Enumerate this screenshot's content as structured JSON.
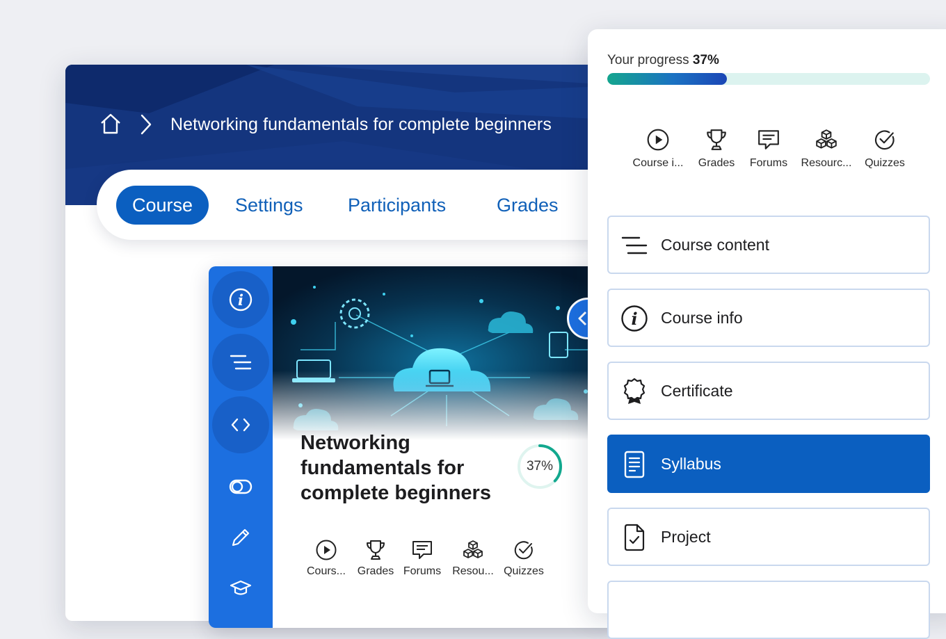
{
  "header": {
    "home_icon": "home-icon",
    "breadcrumb_title": "Networking fundamentals for complete beginners"
  },
  "tabs": [
    {
      "label": "Course",
      "active": true
    },
    {
      "label": "Settings",
      "active": false
    },
    {
      "label": "Participants",
      "active": false
    },
    {
      "label": "Grades",
      "active": false
    }
  ],
  "course_card": {
    "title": "Networking fundamentals for complete beginners",
    "progress_text": "37%",
    "progress_value": 0.37,
    "rail_icons": [
      "info-icon",
      "course-index-icon",
      "code-icon",
      "toggle-icon",
      "pencil-icon",
      "graduation-cap-icon"
    ],
    "quick_access": [
      {
        "label": "Cours...",
        "icon": "play-icon"
      },
      {
        "label": "Grades",
        "icon": "trophy-icon"
      },
      {
        "label": "Forums",
        "icon": "forum-icon"
      },
      {
        "label": "Resou...",
        "icon": "cubes-icon"
      },
      {
        "label": "Quizzes",
        "icon": "check-circle-icon"
      }
    ]
  },
  "panel": {
    "progress_label": "Your progress",
    "progress_value_text": "37%",
    "progress_value": 0.37,
    "quick_access": [
      {
        "label": "Course i...",
        "icon": "play-icon"
      },
      {
        "label": "Grades",
        "icon": "trophy-icon"
      },
      {
        "label": "Forums",
        "icon": "forum-icon"
      },
      {
        "label": "Resourc...",
        "icon": "cubes-icon"
      },
      {
        "label": "Quizzes",
        "icon": "check-circle-icon"
      }
    ],
    "nav_items": [
      {
        "label": "Course content",
        "icon": "course-index-icon",
        "active": false
      },
      {
        "label": "Course info",
        "icon": "info-icon",
        "active": false
      },
      {
        "label": "Certificate",
        "icon": "certificate-icon",
        "active": false
      },
      {
        "label": "Syllabus",
        "icon": "document-icon",
        "active": true
      },
      {
        "label": "Project",
        "icon": "file-check-icon",
        "active": false
      }
    ]
  },
  "colors": {
    "brand_blue": "#0b5fc0",
    "hero_navy": "#14357e",
    "rail_blue": "#1c6fe0",
    "progress_teal": "#14a58e"
  }
}
